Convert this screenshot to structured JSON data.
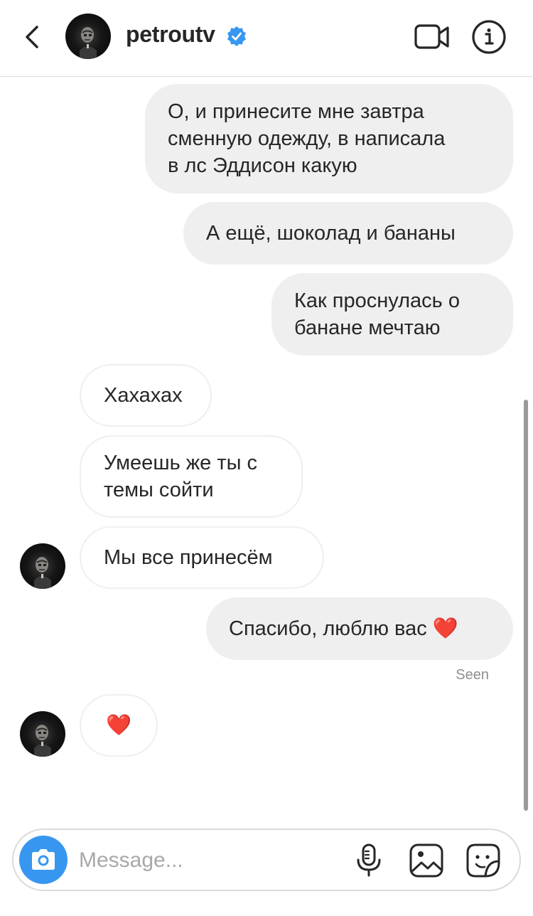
{
  "header": {
    "username": "petroutv",
    "verified": true
  },
  "messages": [
    {
      "direction": "outgoing",
      "text": "О, и принесите мне завтра\nсменную одежду, в написала\nв лс Эддисон какую"
    },
    {
      "direction": "outgoing",
      "text": "А ещё, шоколад и бананы"
    },
    {
      "direction": "outgoing",
      "text": "Как проснулась о\nбанане мечтаю"
    },
    {
      "direction": "incoming",
      "text": "Хахахах"
    },
    {
      "direction": "incoming",
      "text": "Умеешь же ты с\nтемы сойти"
    },
    {
      "direction": "incoming",
      "text": "Мы все принесём"
    },
    {
      "direction": "outgoing",
      "text": "Спасибо, люблю вас ❤️"
    },
    {
      "direction": "incoming",
      "text": "❤️"
    }
  ],
  "seen_label": "Seen",
  "composer": {
    "placeholder": "Message..."
  },
  "colors": {
    "accent": "#3797f0",
    "outgoing_bubble": "#efefef",
    "verified_badge": "#3897f0",
    "heart": "#e0245e"
  },
  "icons": [
    "back-icon",
    "video-call-icon",
    "info-icon",
    "camera-icon",
    "microphone-icon",
    "gallery-icon",
    "sticker-icon"
  ]
}
